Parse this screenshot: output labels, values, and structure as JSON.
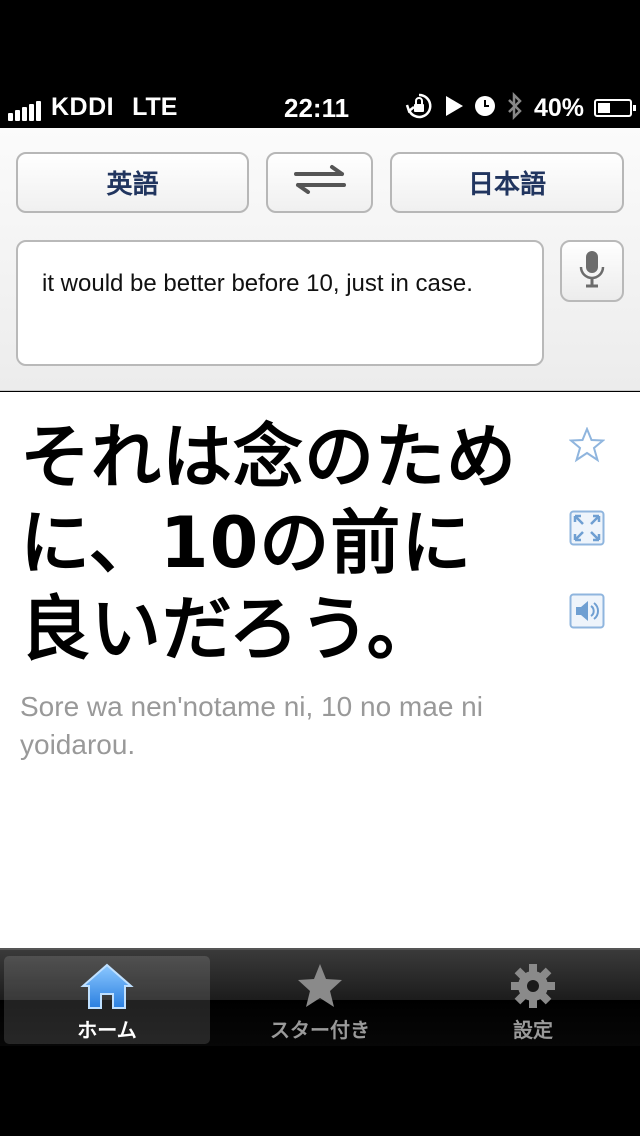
{
  "status_bar": {
    "carrier": "KDDI",
    "network": "LTE",
    "time": "22:11",
    "battery": "40%",
    "battery_level": 0.4,
    "icons": [
      "orientation-lock-icon",
      "play-icon",
      "alarm-icon",
      "bluetooth-icon"
    ]
  },
  "languages": {
    "source": "英語",
    "target": "日本語",
    "swap_icon": "swap-arrows-icon"
  },
  "input": {
    "value": "it would be better before 10, just in case.",
    "mic_icon": "microphone-icon"
  },
  "result": {
    "translation": "それは念のために、10の前に良いだろう。",
    "romanization": "Sore wa nen'notame ni, 10 no mae ni yoidarou.",
    "actions": [
      "star-icon",
      "expand-icon",
      "speaker-icon"
    ]
  },
  "tabs": [
    {
      "label": "ホーム",
      "icon": "home-icon",
      "active": true
    },
    {
      "label": "スター付き",
      "icon": "star-icon",
      "active": false
    },
    {
      "label": "設定",
      "icon": "gear-icon",
      "active": false
    }
  ],
  "colors": {
    "button_text": "#21355f",
    "accent_blue": "#4a90d9",
    "romaji_gray": "#999999"
  }
}
